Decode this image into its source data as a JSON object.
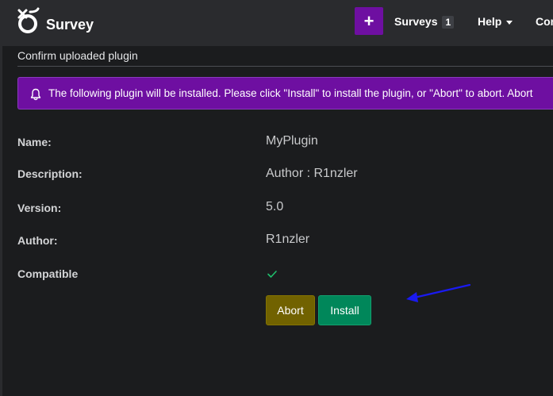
{
  "header": {
    "brand": "Survey",
    "add_label": "+",
    "nav": {
      "surveys_label": "Surveys",
      "surveys_count": "1",
      "help_label": "Help",
      "more_label": "Con"
    }
  },
  "page": {
    "title": "Confirm uploaded plugin",
    "alert_text": "The following plugin will be installed. Please click \"Install\" to install the plugin, or \"Abort\" to abort. Abort"
  },
  "plugin": {
    "rows": [
      {
        "label": "Name:",
        "value": "MyPlugin"
      },
      {
        "label": "Description:",
        "value": "Author : R1nzler"
      },
      {
        "label": "Version:",
        "value": "5.0"
      },
      {
        "label": "Author:",
        "value": "R1nzler"
      },
      {
        "label": "Compatible",
        "value": ""
      }
    ],
    "compatible_icon": "check-icon"
  },
  "actions": {
    "abort_label": "Abort",
    "install_label": "Install"
  },
  "colors": {
    "accent": "#6e0fa1",
    "abort": "#716200",
    "install": "#00875a",
    "check": "#1fbf6c",
    "annotation_arrow": "#1a1af0"
  }
}
